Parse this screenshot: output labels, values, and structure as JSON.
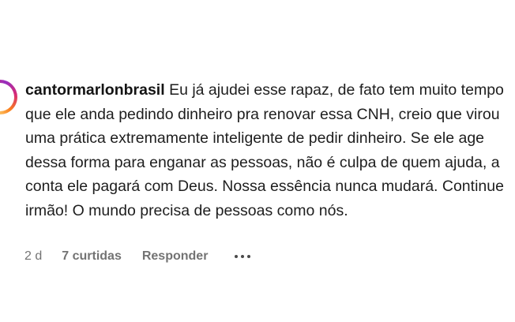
{
  "comment": {
    "username": "cantormarlonbrasil",
    "text": "Eu já ajudei esse rapaz, de fato tem muito tempo que ele anda pedindo dinheiro pra renovar essa CNH, creio que virou uma prática extremamente inteligente de pedir dinheiro. Se ele age dessa forma para enganar as pessoas, não é culpa de quem ajuda, a conta ele pagará com Deus. Nossa essência nunca mudará. Continue irmão! O mundo precisa de pessoas como nós."
  },
  "actions": {
    "time": "2 d",
    "likes": "7 curtidas",
    "reply": "Responder",
    "more_icon": "more-horizontal-icon"
  },
  "colors": {
    "meta_text": "#737373",
    "body_text": "#1e1e1e",
    "avatar_ring": [
      "#feda75",
      "#fa7e1e",
      "#d62976",
      "#962fbf"
    ]
  }
}
